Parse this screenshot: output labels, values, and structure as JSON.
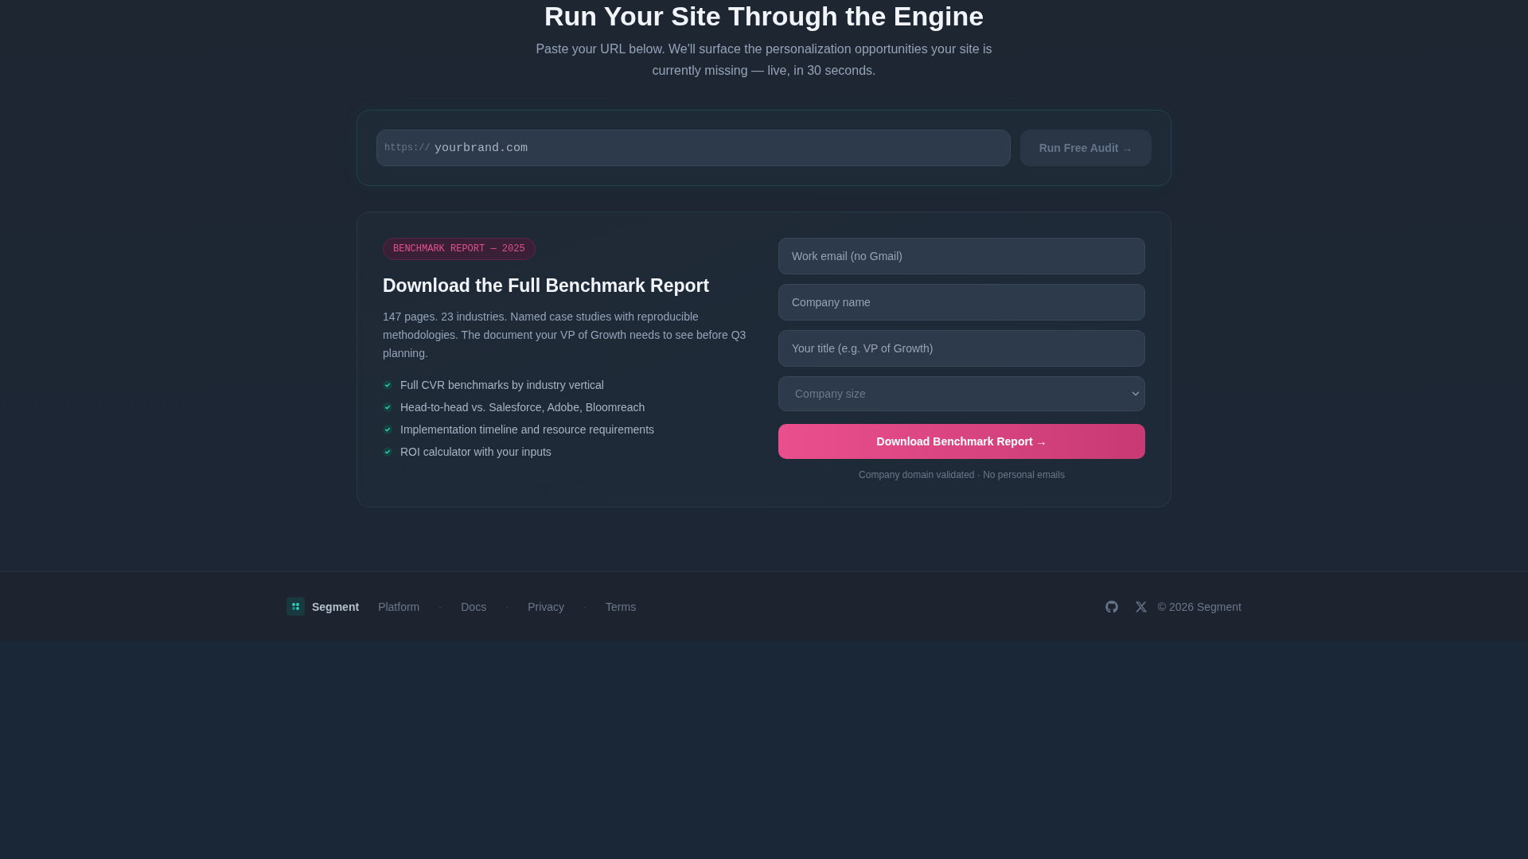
{
  "hero": {
    "title": "Run Your Site Through the Engine",
    "subtitle": "Paste your URL below. We'll surface the personalization opportunities your site is currently missing — live, in 30 seconds."
  },
  "audit": {
    "url_field": {
      "prefix": "https://",
      "placeholder": "yourbrand.com"
    },
    "button": {
      "label": "Run Free Audit →",
      "disabled": true
    }
  },
  "report": {
    "badge": "BENCHMARK REPORT — 2025",
    "title": "Download the Full Benchmark Report",
    "description": "147 pages. 23 industries. Named case studies with reproducible methodologies. The document your VP of Growth needs to see before Q3 planning.",
    "features": [
      "Full CVR benchmarks by industry vertical",
      "Head-to-head vs. Salesforce, Adobe, Bloomreach",
      "Implementation timeline and resource requirements",
      "ROI calculator with your inputs"
    ],
    "fields": [
      {
        "kind": "input",
        "placeholder": "Work email (no Gmail)"
      },
      {
        "kind": "input",
        "placeholder": "Company name"
      },
      {
        "kind": "input",
        "placeholder": "Your title (e.g. VP of Growth)"
      },
      {
        "kind": "select",
        "placeholder": "Company size"
      }
    ],
    "submit": "Download Benchmark Report →",
    "note": "Company domain validated · No personal emails"
  },
  "footer": {
    "brand": "Segment",
    "nav": [
      {
        "kind": "link",
        "label": "Platform"
      },
      {
        "kind": "separator",
        "label": "·"
      },
      {
        "kind": "link",
        "label": "Docs"
      },
      {
        "kind": "separator",
        "label": "·"
      },
      {
        "kind": "link",
        "label": "Privacy"
      },
      {
        "kind": "separator",
        "label": "·"
      },
      {
        "kind": "link",
        "label": "Terms"
      }
    ],
    "copyright": "© 2026 Segment"
  }
}
